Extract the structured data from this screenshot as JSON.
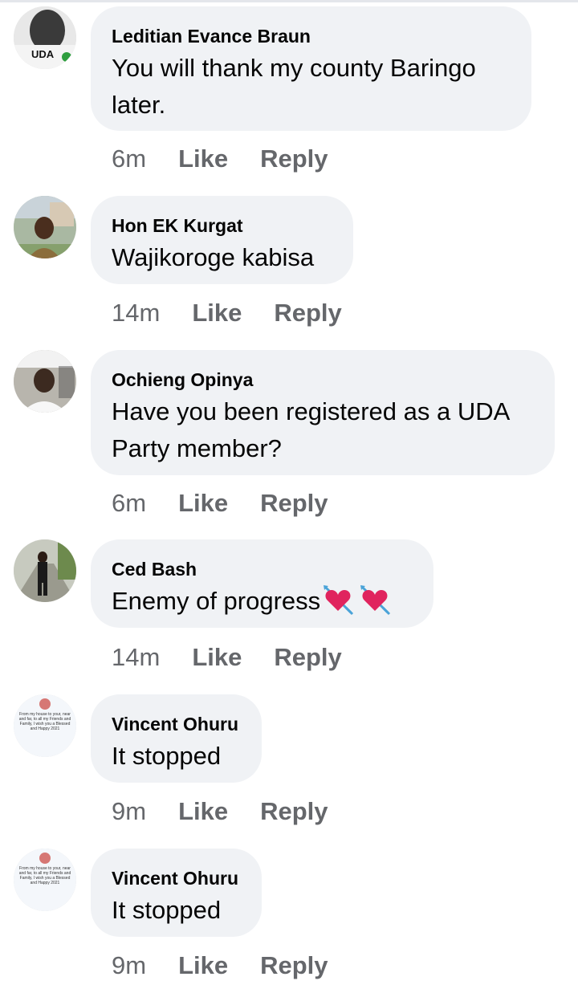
{
  "comments": [
    {
      "author": "Leditian Evance Braun",
      "text": "You will thank my county Baringo later.",
      "time": "6m",
      "like": "Like",
      "reply": "Reply",
      "avatar_text": "UDA"
    },
    {
      "author": "Hon EK Kurgat",
      "text": "Wajikoroge kabisa",
      "time": "14m",
      "like": "Like",
      "reply": "Reply"
    },
    {
      "author": "Ochieng Opinya",
      "text": "Have you been registered as a UDA Party member?",
      "time": "6m",
      "like": "Like",
      "reply": "Reply"
    },
    {
      "author": "Ced Bash",
      "text": "Enemy of progress",
      "time": "14m",
      "like": "Like",
      "reply": "Reply",
      "emoji": [
        "heart-with-arrow-icon",
        "heart-with-arrow-icon"
      ]
    },
    {
      "author": "Vincent Ohuru",
      "text": "It stopped",
      "time": "9m",
      "like": "Like",
      "reply": "Reply",
      "avatar_text": "From my house to your, near and far, to all my Friends and Family, I wish you a Blessed and Happy 2021"
    },
    {
      "author": "Vincent Ohuru",
      "text": "It stopped",
      "time": "9m",
      "like": "Like",
      "reply": "Reply",
      "avatar_text": "From my house to your, near and far, to all my Friends and Family, I wish you a Blessed and Happy 2021"
    }
  ],
  "colors": {
    "bubble": "#f0f2f5",
    "meta": "#65676b",
    "heart": "#e0245e"
  }
}
